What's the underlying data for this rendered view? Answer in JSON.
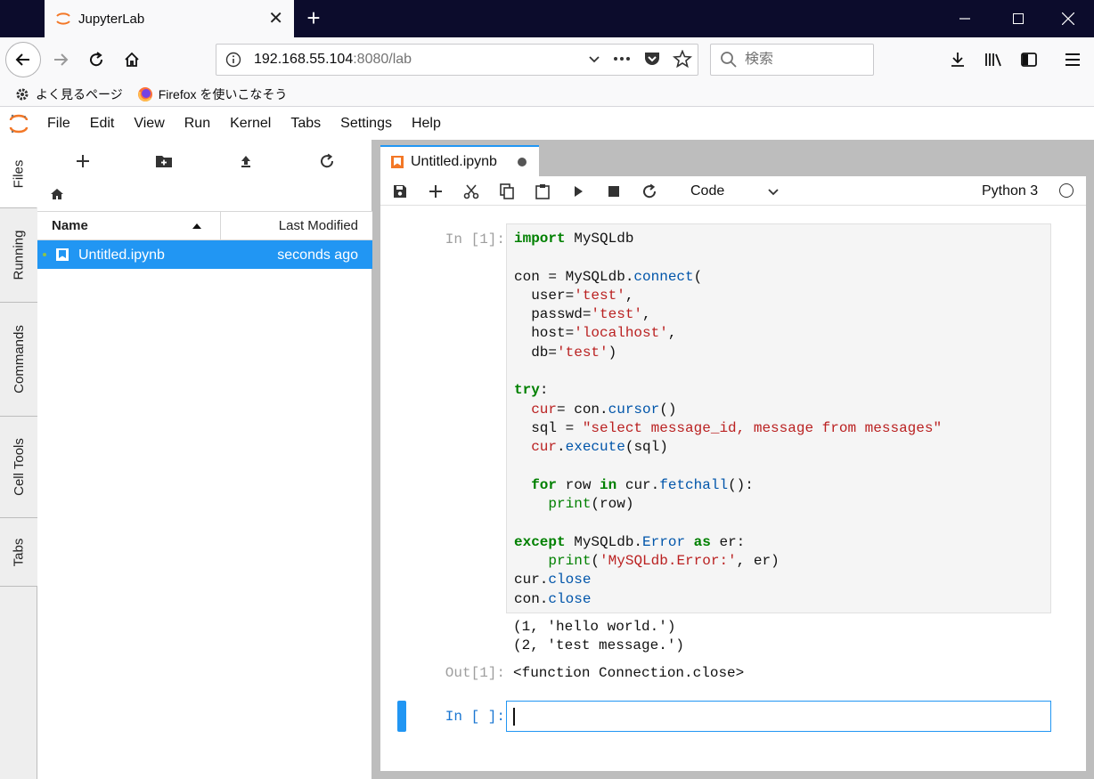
{
  "browser": {
    "tab_title": "JupyterLab",
    "close_tab": "✕",
    "new_tab": "+",
    "url_host": "192.168.55.104",
    "url_rest": ":8080/lab",
    "search_placeholder": "検索",
    "bookmarks": [
      {
        "label": "よく見るページ"
      },
      {
        "label": "Firefox を使いこなそう"
      }
    ]
  },
  "jupyter": {
    "menu": [
      "File",
      "Edit",
      "View",
      "Run",
      "Kernel",
      "Tabs",
      "Settings",
      "Help"
    ],
    "left_tabs": [
      "Files",
      "Running",
      "Commands",
      "Cell Tools",
      "Tabs"
    ],
    "filebrowser": {
      "col_name": "Name",
      "col_modified": "Last Modified",
      "files": [
        {
          "name": "Untitled.ipynb",
          "modified": "seconds ago"
        }
      ]
    },
    "notebook": {
      "tab_title": "Untitled.ipynb",
      "cell_type": "Code",
      "kernel": "Python 3",
      "cell1_prompt": "In [1]:",
      "out_prompt": "Out[1]:",
      "outputs": [
        "(1, 'hello world.')",
        "(2, 'test message.')"
      ],
      "result": "<function Connection.close>",
      "cell2_prompt": "In [ ]:"
    }
  }
}
